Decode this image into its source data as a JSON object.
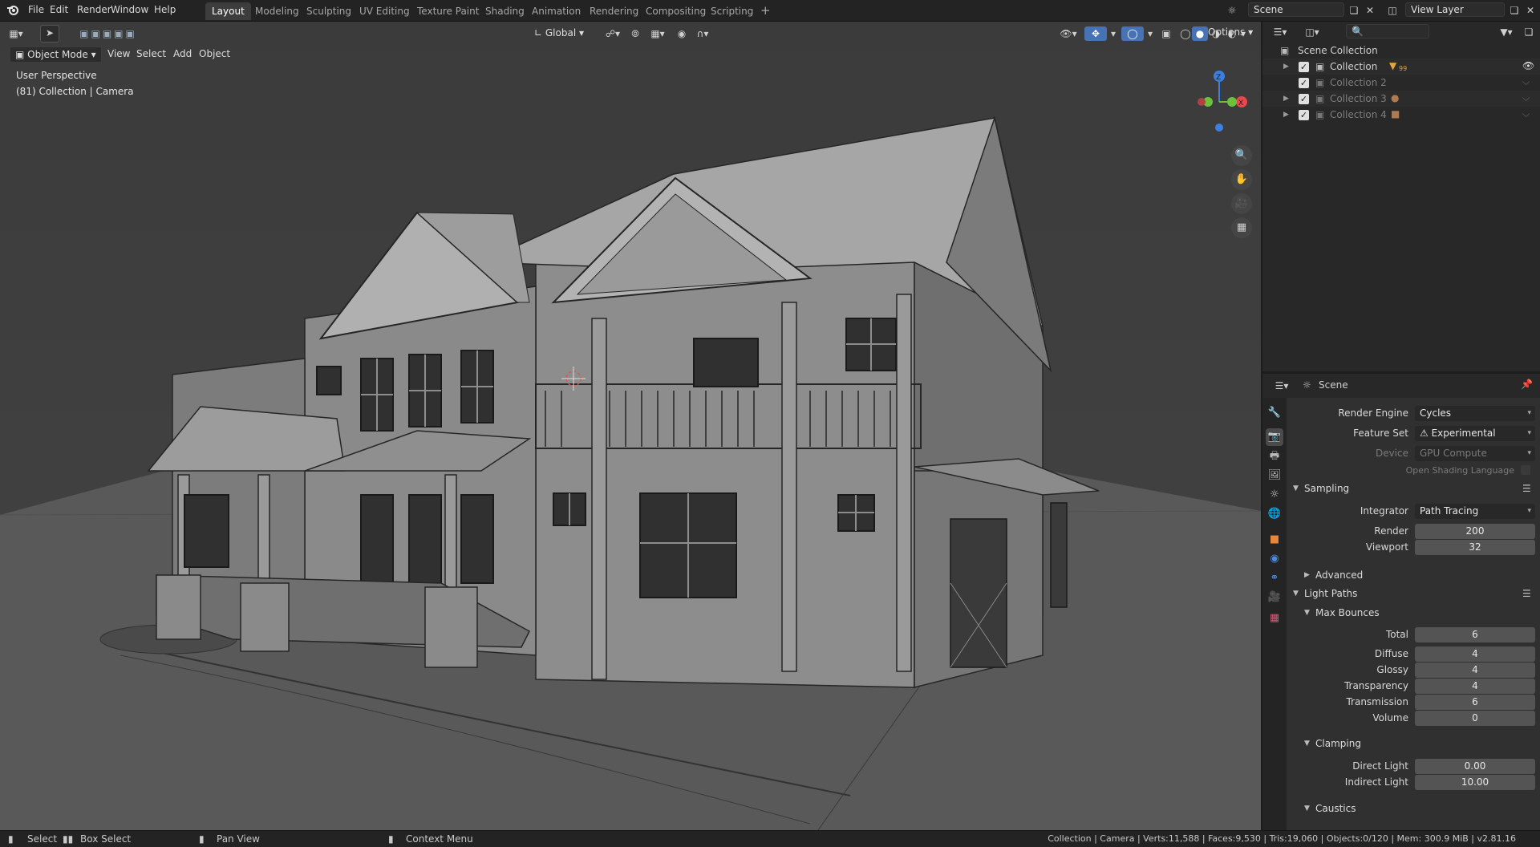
{
  "topbar": {
    "menus": [
      "File",
      "Edit",
      "Render",
      "Window",
      "Help"
    ],
    "workspaces": [
      "Layout",
      "Modeling",
      "Sculpting",
      "UV Editing",
      "Texture Paint",
      "Shading",
      "Animation",
      "Rendering",
      "Compositing",
      "Scripting"
    ],
    "active_workspace": "Layout",
    "add_tab": "+",
    "scene_name": "Scene",
    "view_layer": "View Layer"
  },
  "viewport": {
    "mode": "Object Mode",
    "menus": [
      "View",
      "Select",
      "Add",
      "Object"
    ],
    "orientation": "Global",
    "options": "Options",
    "perspective_label": "User Perspective",
    "context_label": "(81) Collection | Camera",
    "gizmo_axes": {
      "z": "Z",
      "x": "X"
    }
  },
  "outliner": {
    "root": "Scene Collection",
    "collections": [
      {
        "name": "Collection",
        "enabled": true,
        "dim": false,
        "badge": "99"
      },
      {
        "name": "Collection 2",
        "enabled": true,
        "dim": true,
        "badge": ""
      },
      {
        "name": "Collection 3",
        "enabled": true,
        "dim": true,
        "badge": ""
      },
      {
        "name": "Collection 4",
        "enabled": true,
        "dim": true,
        "badge": ""
      }
    ]
  },
  "properties": {
    "context": "Scene",
    "render_engine_label": "Render Engine",
    "render_engine": "Cycles",
    "feature_set_label": "Feature Set",
    "feature_set": "Experimental",
    "device_label": "Device",
    "device": "GPU Compute",
    "osl_label": "Open Shading Language",
    "sampling": {
      "title": "Sampling",
      "integrator_label": "Integrator",
      "integrator": "Path Tracing",
      "render_label": "Render",
      "render": "200",
      "viewport_label": "Viewport",
      "viewport": "32",
      "advanced": "Advanced"
    },
    "light_paths": {
      "title": "Light Paths",
      "max_bounces": "Max Bounces",
      "rows": [
        {
          "label": "Total",
          "value": "6"
        },
        {
          "label": "Diffuse",
          "value": "4"
        },
        {
          "label": "Glossy",
          "value": "4"
        },
        {
          "label": "Transparency",
          "value": "4"
        },
        {
          "label": "Transmission",
          "value": "6"
        },
        {
          "label": "Volume",
          "value": "0"
        }
      ],
      "clamping": "Clamping",
      "direct_light_label": "Direct Light",
      "direct_light": "0.00",
      "indirect_light_label": "Indirect Light",
      "indirect_light": "10.00",
      "caustics": "Caustics"
    }
  },
  "statusbar": {
    "select": "Select",
    "box_select": "Box Select",
    "pan_view": "Pan View",
    "context_menu": "Context Menu",
    "stats": "Collection | Camera | Verts:11,588 | Faces:9,530 | Tris:19,060 | Objects:0/120 | Mem: 300.9 MiB | v2.81.16"
  },
  "colors": {
    "accent": "#4772b3",
    "axis_x": "#e8474c",
    "axis_y": "#6ac23b",
    "axis_z": "#3c7fe0"
  }
}
